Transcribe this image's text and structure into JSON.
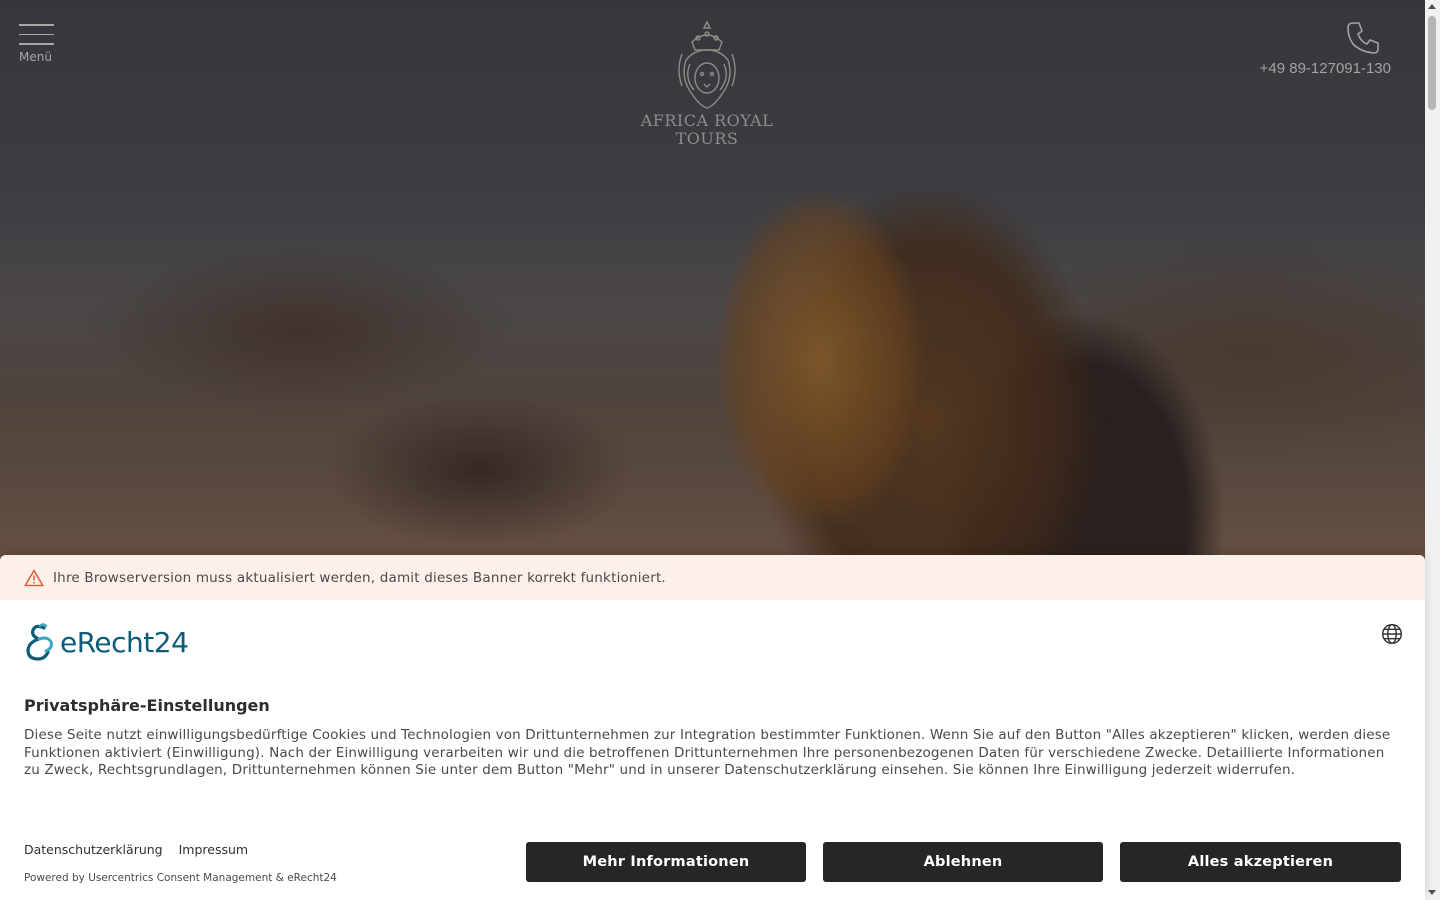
{
  "header": {
    "menu_label": "Menü",
    "logo_text_line1": "AFRICA ROYAL",
    "logo_text_line2": "TOURS",
    "phone_number": "+49 89-127091-130"
  },
  "consent": {
    "warning_text": "Ihre Browserversion muss aktualisiert werden, damit dieses Banner korrekt funktioniert.",
    "brand_name": "eRecht24",
    "title": "Privatsphäre-Einstellungen",
    "description": "Diese Seite nutzt einwilligungsbedürftige Cookies und Technologien von Drittunternehmen zur Integration bestimmter Funktionen. Wenn Sie auf den Button \"Alles akzeptieren\" klicken, werden diese Funktionen aktiviert (Einwilligung). Nach der Einwilligung verarbeiten wir und die betroffenen Drittunternehmen Ihre personenbezogenen Daten für verschiedene Zwecke. Detaillierte Informationen zu Zweck, Rechtsgrundlagen, Drittunternehmen können Sie unter dem Button \"Mehr\" und in unserer Datenschutzerklärung einsehen. Sie können Ihre Einwilligung jederzeit widerrufen.",
    "links": {
      "privacy": "Datenschutzerklärung",
      "imprint": "Impressum"
    },
    "powered_by": "Powered by Usercentrics Consent Management & eRecht24",
    "buttons": {
      "more": "Mehr Informationen",
      "deny": "Ablehnen",
      "accept": "Alles akzeptieren"
    }
  },
  "colors": {
    "brand": "#0b5b79",
    "button_bg": "#262626",
    "warning_bg": "#fdf0ea",
    "warning_icon": "#e0603a"
  },
  "icons": {
    "menu": "hamburger-icon",
    "phone": "phone-icon",
    "warning": "warning-triangle-icon",
    "language": "globe-icon",
    "brand": "erecht24-logo"
  }
}
